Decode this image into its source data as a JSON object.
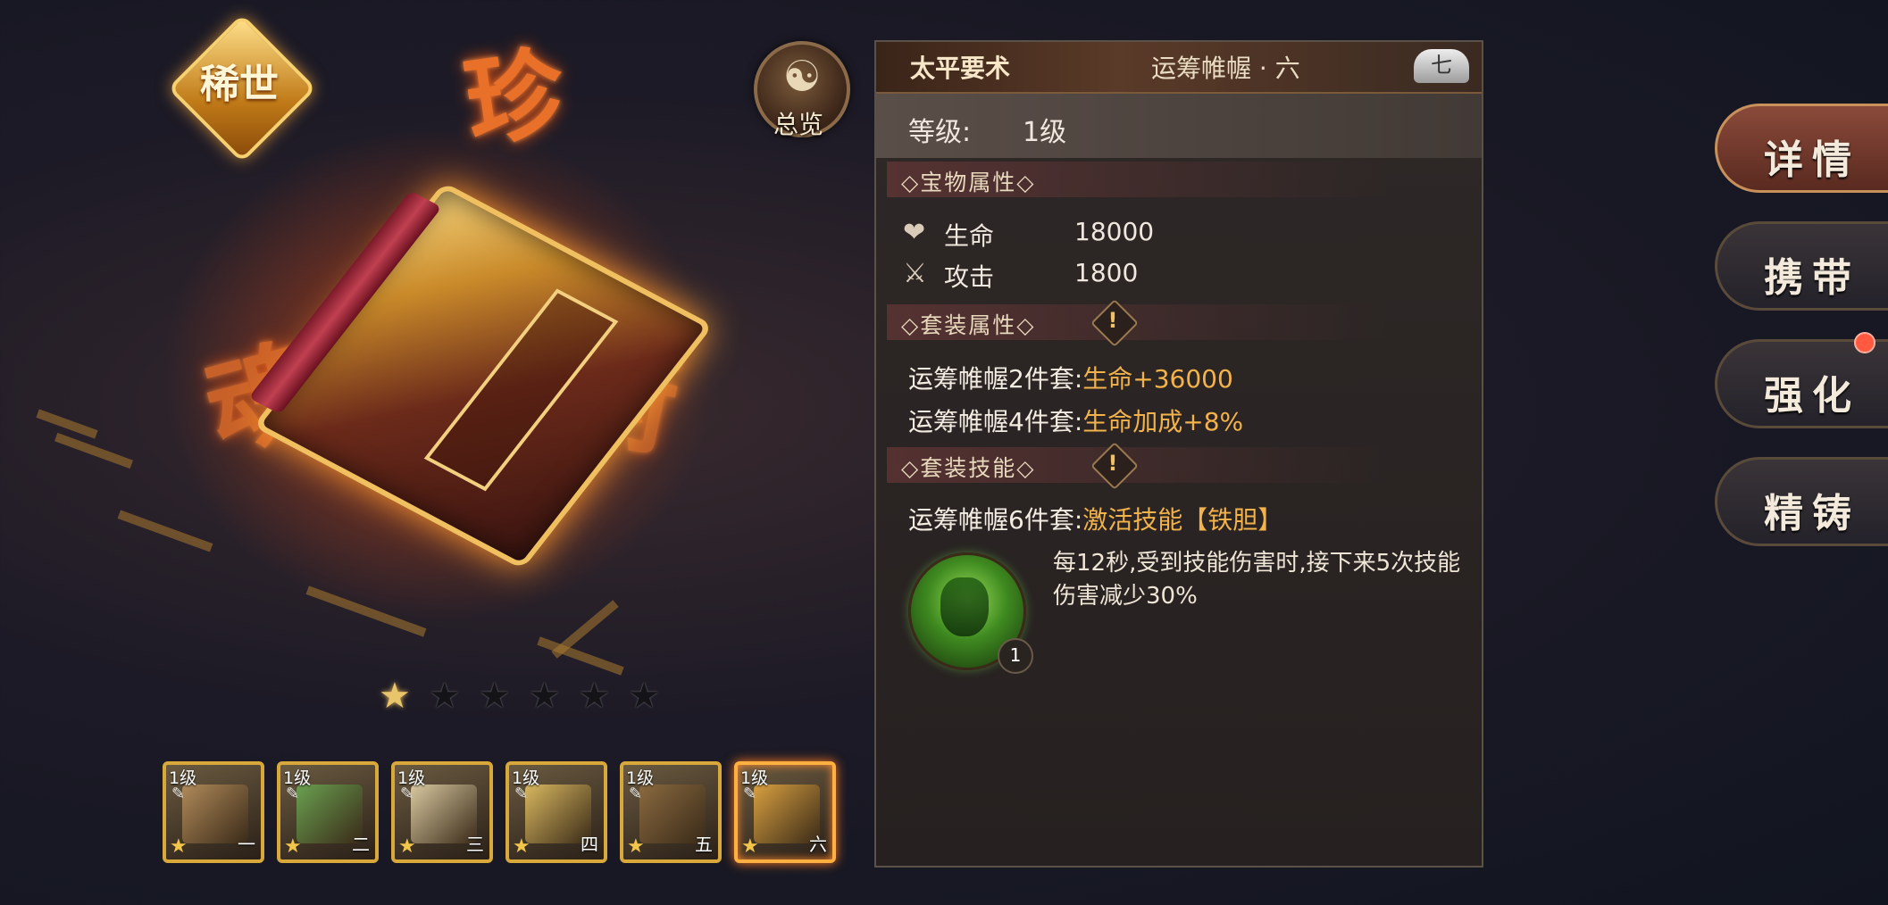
{
  "showcase": {
    "rarity": "稀世",
    "overview": {
      "symbol": "☯",
      "label": "总览"
    },
    "stars": {
      "filled": 1,
      "total": 6
    },
    "flames": [
      "珍",
      "魂",
      "術",
      "吉"
    ]
  },
  "slots": [
    {
      "level": "1级",
      "number": "一",
      "tool": "✎",
      "star": "★",
      "color": "#b08a5a"
    },
    {
      "level": "1级",
      "number": "二",
      "tool": "✎",
      "star": "★",
      "color": "#6aa050"
    },
    {
      "level": "1级",
      "number": "三",
      "tool": "✎",
      "star": "★",
      "color": "#d8c8a0"
    },
    {
      "level": "1级",
      "number": "四",
      "tool": "✎",
      "star": "★",
      "color": "#d8b860"
    },
    {
      "level": "1级",
      "number": "五",
      "tool": "✎",
      "star": "★",
      "color": "#8a6a40"
    },
    {
      "level": "1级",
      "number": "六",
      "tool": "✎",
      "star": "★",
      "color": "#d8a040"
    }
  ],
  "panel": {
    "item_name": "太平要术",
    "set_name": "运筹帷幄 · 六",
    "decor": "七",
    "level_label": "等级:",
    "level_value": "1级",
    "sections": {
      "treasure_attr": "◇宝物属性◇",
      "set_attr": "◇套装属性◇",
      "set_skill": "◇套装技能◇"
    },
    "warn_mark": "!",
    "stats": [
      {
        "icon": "❤",
        "label": "生命",
        "value": "18000"
      },
      {
        "icon": "⚔",
        "label": "攻击",
        "value": "1800"
      }
    ],
    "set_bonuses": [
      {
        "name": "运筹帷幄2件套:",
        "bonus": "生命+36000"
      },
      {
        "name": "运筹帷幄4件套:",
        "bonus": "生命加成+8%"
      }
    ],
    "skill": {
      "set_name": "运筹帷幄6件套:",
      "effect": "激活技能【铁胆】",
      "level": "1",
      "description": "每12秒,受到技能伤害时,接下来5次技能伤害减少30%"
    }
  },
  "tabs": [
    "详情",
    "携带",
    "强化",
    "精铸"
  ]
}
